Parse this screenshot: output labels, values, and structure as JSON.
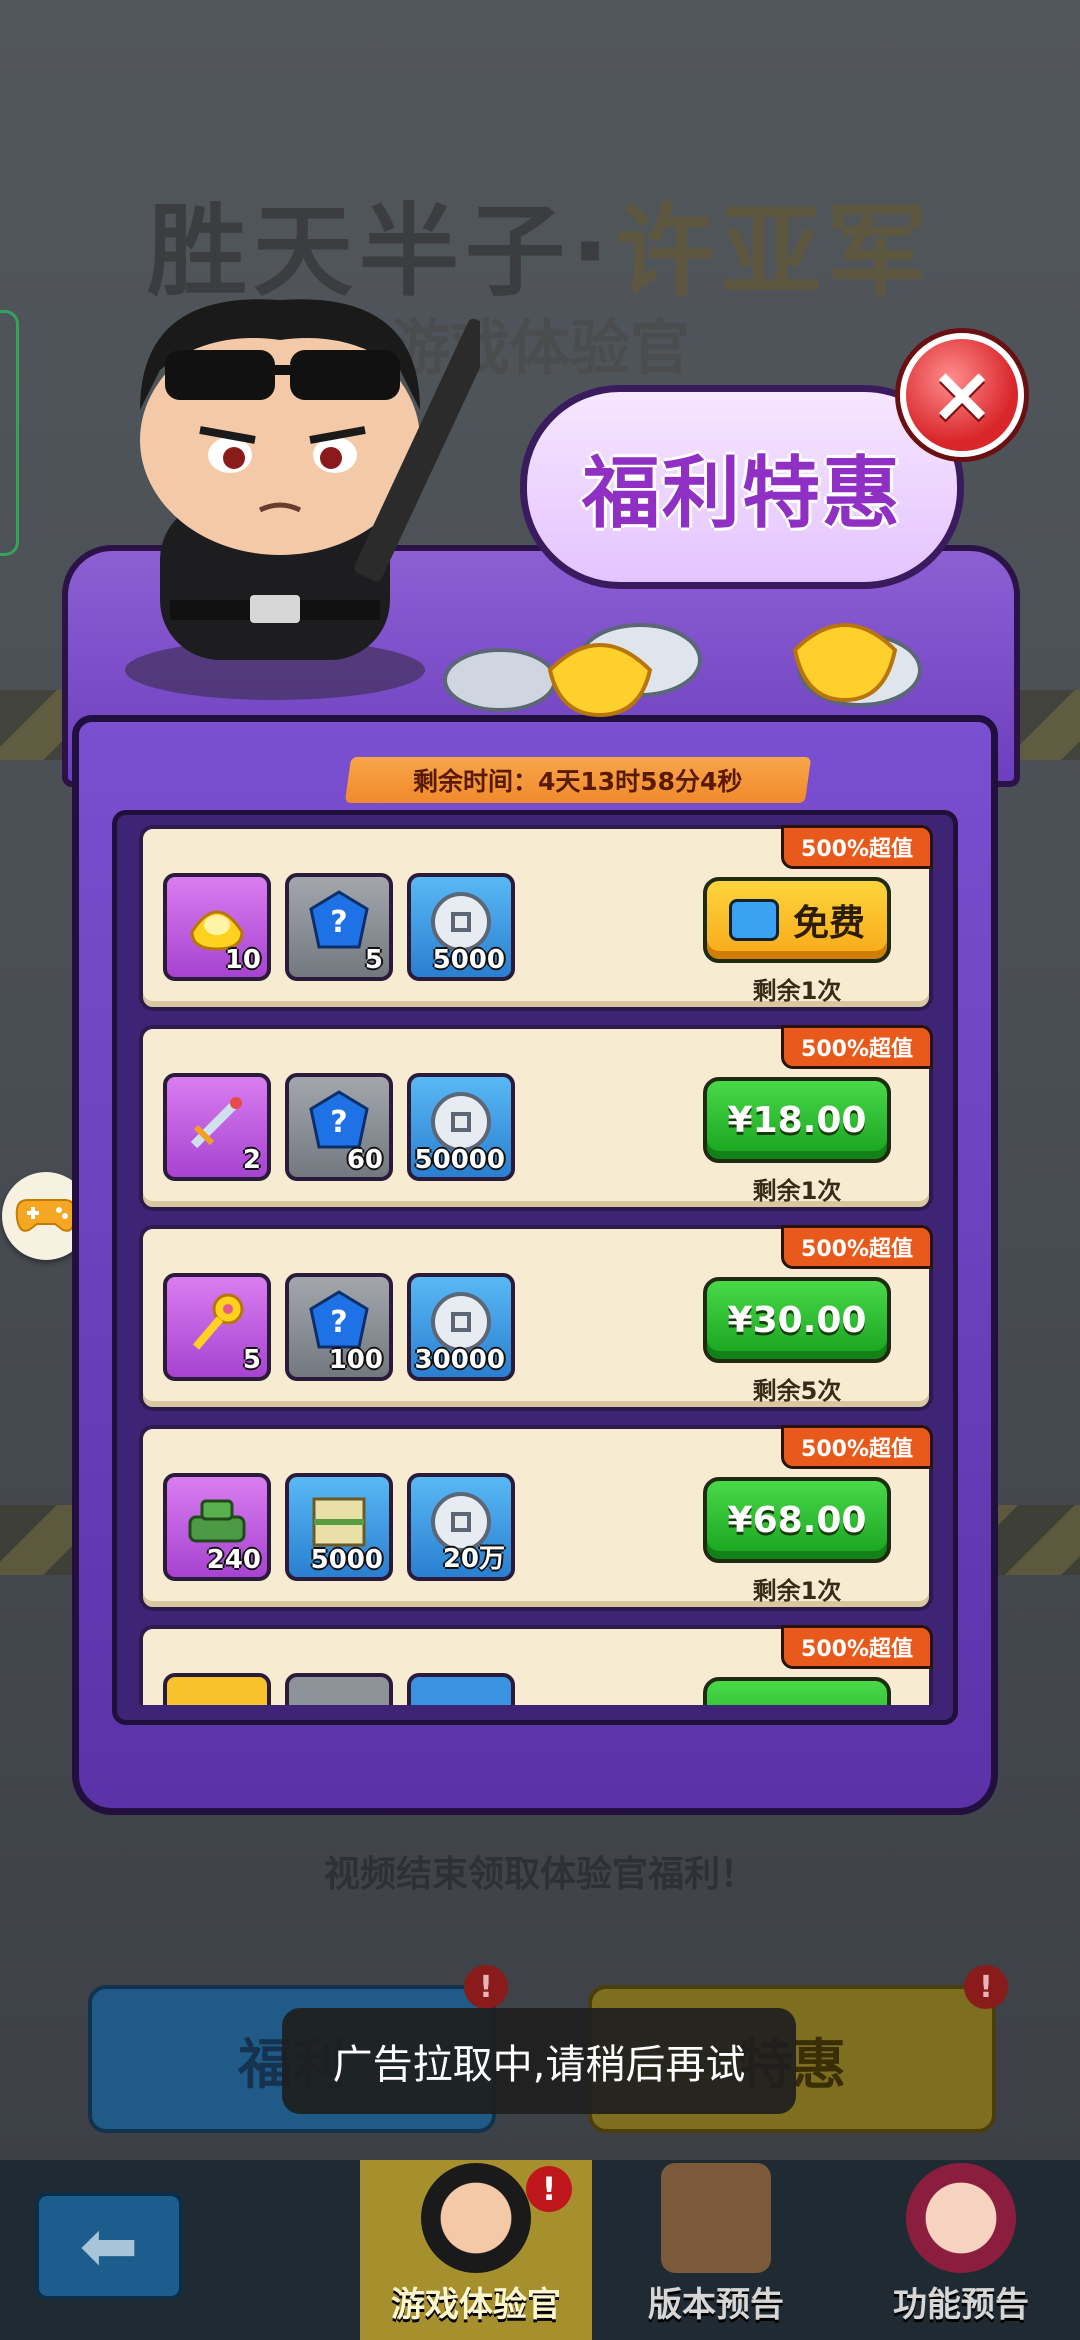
{
  "background": {
    "title_left": "胜天半子·",
    "title_right": "许亚军",
    "subtitle": "游戏体验官",
    "desc": "视频结束领取体验官福利！",
    "btn_left": "福利",
    "btn_right": "特惠",
    "badge": "!"
  },
  "popup": {
    "bubble_text": "福利特惠",
    "timer": "剩余时间：4天13时58分4秒",
    "close_icon": "×",
    "packs": [
      {
        "tag": "500%超值",
        "items": [
          {
            "icon": "gold-ingot",
            "qty": "10",
            "color": "purple"
          },
          {
            "icon": "blue-gem",
            "qty": "5",
            "color": "gray"
          },
          {
            "icon": "silver-coin",
            "qty": "5000",
            "color": "blue"
          }
        ],
        "button": "免费",
        "button_style": "yellow",
        "remain": "剩余1次"
      },
      {
        "tag": "500%超值",
        "items": [
          {
            "icon": "sword",
            "qty": "2",
            "color": "purple"
          },
          {
            "icon": "blue-gem",
            "qty": "60",
            "color": "gray"
          },
          {
            "icon": "silver-coin",
            "qty": "50000",
            "color": "blue"
          }
        ],
        "button": "¥18.00",
        "button_style": "green",
        "remain": "剩余1次"
      },
      {
        "tag": "500%超值",
        "items": [
          {
            "icon": "golden-key",
            "qty": "5",
            "color": "purple"
          },
          {
            "icon": "blue-gem",
            "qty": "100",
            "color": "gray"
          },
          {
            "icon": "silver-coin",
            "qty": "30000",
            "color": "blue"
          }
        ],
        "button": "¥30.00",
        "button_style": "green",
        "remain": "剩余5次"
      },
      {
        "tag": "500%超值",
        "items": [
          {
            "icon": "green-vehicle",
            "qty": "240",
            "color": "purple"
          },
          {
            "icon": "map-scroll",
            "qty": "5000",
            "color": "blue"
          },
          {
            "icon": "silver-coin",
            "qty": "20万",
            "color": "blue"
          }
        ],
        "button": "¥68.00",
        "button_style": "green",
        "remain": "剩余1次"
      },
      {
        "tag": "500%超值",
        "items": [],
        "button": "",
        "button_style": "green",
        "remain": ""
      }
    ]
  },
  "toast": "广告拉取中,请稍后再试",
  "bottom_tabs": [
    {
      "label": "游戏体验官",
      "active": true,
      "badge": "!"
    },
    {
      "label": "版本预告",
      "active": false
    },
    {
      "label": "功能预告",
      "active": false
    }
  ],
  "colors": {
    "popup_purple": "#6d3fbf",
    "card_bg": "#f7ecd1",
    "tag_orange": "#e8591b",
    "buy_green": "#17a21e",
    "free_yellow": "#f7a91a"
  }
}
